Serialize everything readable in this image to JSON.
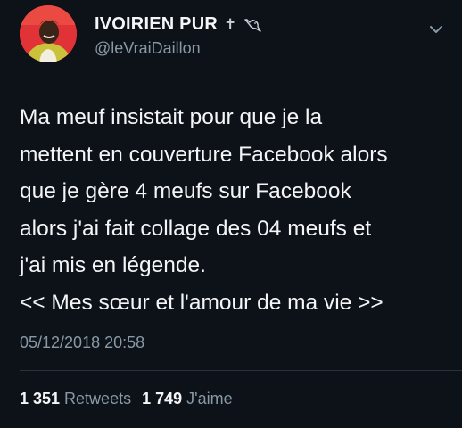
{
  "author": {
    "display_name": "IVOIRIEN PUR",
    "name_emojis": "✝",
    "handle": "@leVraiDaillon"
  },
  "tweet": {
    "lines": [
      "Ma meuf insistait pour que je la",
      "mettent en couverture Facebook alors",
      "que je gère 4 meufs sur Facebook",
      "alors j'ai fait collage des 04 meufs et",
      "j'ai mis en légende.",
      "<< Mes sœur et l'amour de ma vie >>"
    ],
    "timestamp": "05/12/2018 20:58"
  },
  "stats": {
    "retweets_count": "1 351",
    "retweets_label": "Retweets",
    "likes_count": "1 749",
    "likes_label": "J'aime"
  },
  "colors": {
    "background": "#0d1118",
    "text": "#f3f5f7",
    "secondary_text": "#8899a6",
    "divider": "#2a323c"
  },
  "icons": {
    "name_badge": "bird-icon",
    "menu": "chevron-down-icon"
  }
}
